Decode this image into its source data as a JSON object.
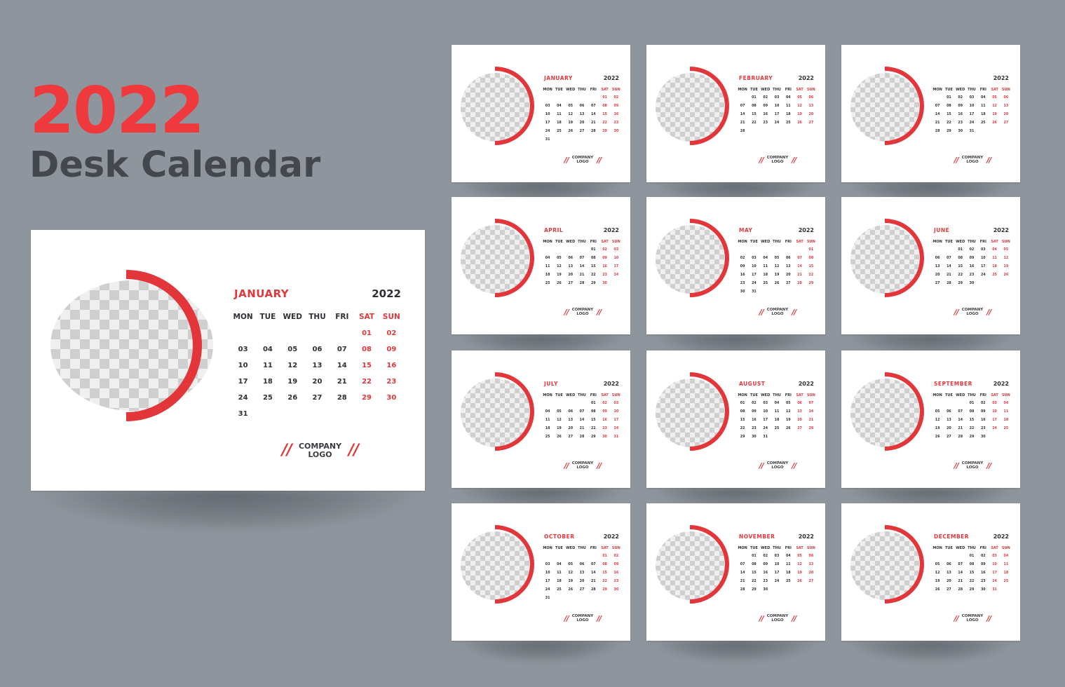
{
  "hero": {
    "year": "2022",
    "subtitle": "Desk Calendar"
  },
  "colors": {
    "background": "#8f959c",
    "accent": "#e2363a",
    "hero_year": "#f0393d",
    "hero_subtitle": "#44474c",
    "text_dark": "#2e3034",
    "card": "#ffffff"
  },
  "weekday_headers": [
    "MON",
    "TUE",
    "WED",
    "THU",
    "FRI",
    "SAT",
    "SUN"
  ],
  "weekend_columns": [
    5,
    6
  ],
  "logo": {
    "line1": "COMPANY",
    "line2": "LOGO",
    "mark_left": "//",
    "mark_right": "//"
  },
  "featured": {
    "month": "JANUARY",
    "year": "2022",
    "first_weekday_index": 5,
    "days": 31
  },
  "months": [
    {
      "month": "JANUARY",
      "year": "2022",
      "first_weekday_index": 5,
      "days": 31
    },
    {
      "month": "FEBRUARY",
      "year": "2022",
      "first_weekday_index": 1,
      "days": 28
    },
    {
      "month": "",
      "year": "2022",
      "first_weekday_index": 1,
      "days": 31
    },
    {
      "month": "APRIL",
      "year": "2022",
      "first_weekday_index": 4,
      "days": 30
    },
    {
      "month": "MAY",
      "year": "2022",
      "first_weekday_index": 6,
      "days": 31
    },
    {
      "month": "JUNE",
      "year": "2022",
      "first_weekday_index": 2,
      "days": 30
    },
    {
      "month": "JULY",
      "year": "2022",
      "first_weekday_index": 4,
      "days": 31
    },
    {
      "month": "AUGUST",
      "year": "2022",
      "first_weekday_index": 0,
      "days": 31
    },
    {
      "month": "SEPTEMBER",
      "year": "2022",
      "first_weekday_index": 3,
      "days": 30
    },
    {
      "month": "OCTOBER",
      "year": "2022",
      "first_weekday_index": 5,
      "days": 31
    },
    {
      "month": "NOVEMBER",
      "year": "2022",
      "first_weekday_index": 1,
      "days": 30
    },
    {
      "month": "DECEMBER",
      "year": "2022",
      "first_weekday_index": 3,
      "days": 31
    }
  ]
}
